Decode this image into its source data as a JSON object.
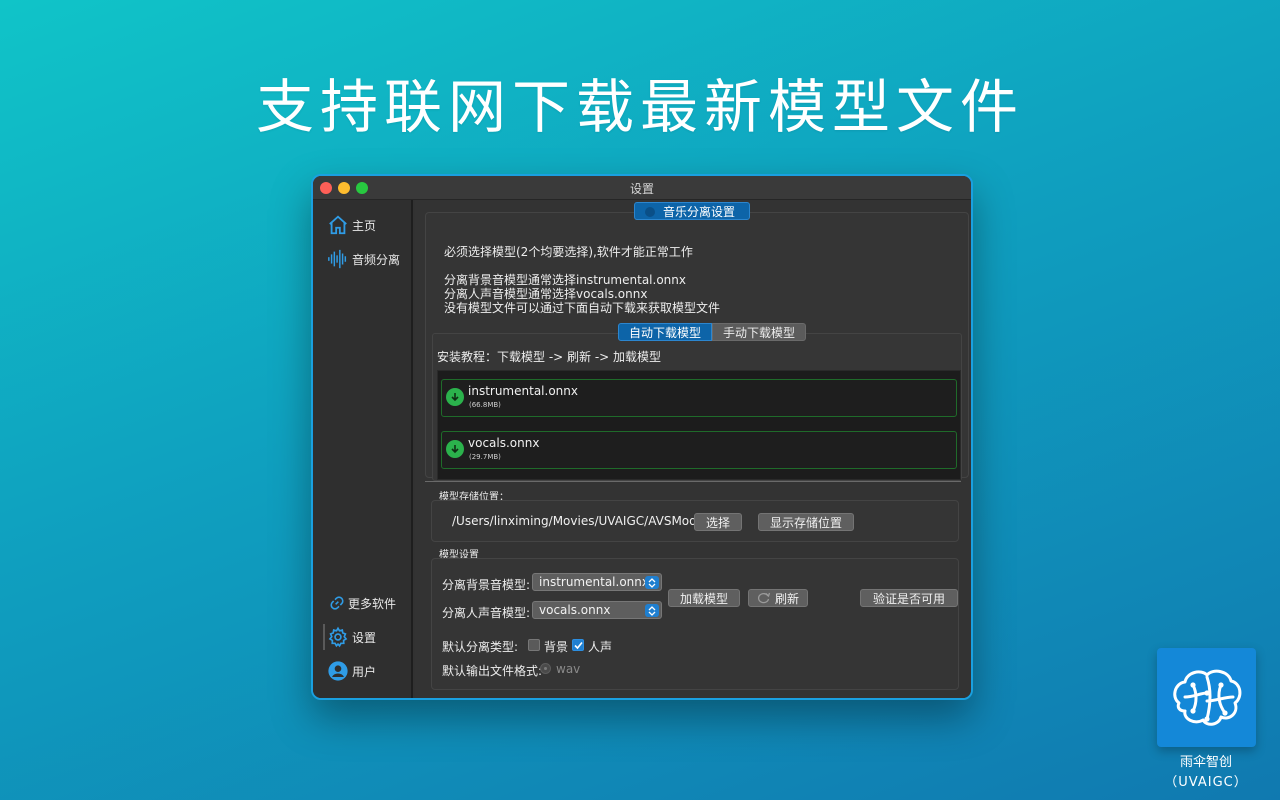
{
  "headline": "支持联网下载最新模型文件",
  "window": {
    "title": "设置"
  },
  "sidebar": {
    "items": [
      {
        "label": "主页",
        "icon": "home-icon"
      },
      {
        "label": "音频分离",
        "icon": "waveform-icon"
      },
      {
        "label": "更多软件",
        "icon": "link-icon"
      },
      {
        "label": "设置",
        "icon": "gear-icon"
      },
      {
        "label": "用户",
        "icon": "user-icon"
      }
    ]
  },
  "music_settings": {
    "title": "音乐分离设置",
    "info_required": "必须选择模型(2个均要选择),软件才能正常工作",
    "info_bg": "分离背景音模型通常选择instrumental.onnx",
    "info_vocal": "分离人声音模型通常选择vocals.onnx",
    "info_download": "没有模型文件可以通过下面自动下载来获取模型文件",
    "tabs": [
      {
        "label": "自动下载模型",
        "active": true
      },
      {
        "label": "手动下载模型",
        "active": false
      }
    ],
    "install_tip": "安装教程：下载模型 -> 刷新 -> 加载模型",
    "downloads": [
      {
        "name": "instrumental.onnx",
        "size": "(66.8MB)"
      },
      {
        "name": "vocals.onnx",
        "size": "(29.7MB)"
      }
    ]
  },
  "storage": {
    "label": "模型存储位置：",
    "path": "/Users/linximing/Movies/UVAIGC/AVSModel",
    "choose_label": "选择",
    "show_label": "显示存储位置"
  },
  "model_settings": {
    "label": "模型设置",
    "bg_label": "分离背景音模型:",
    "bg_value": "instrumental.onnx",
    "vocal_label": "分离人声音模型:",
    "vocal_value": "vocals.onnx",
    "load_label": "加载模型",
    "refresh_label": "刷新",
    "verify_label": "验证是否可用",
    "type_label": "默认分离类型:",
    "type_bg": "背景",
    "type_bg_checked": false,
    "type_vocal": "人声",
    "type_vocal_checked": true,
    "format_label": "默认输出文件格式:",
    "format_value": "wav"
  },
  "brand": {
    "name": "雨伞智创",
    "en": "（UVAIGC）"
  },
  "colors": {
    "accent": "#0d64a8",
    "download": "#2bb24c",
    "frame": "#1aa0e0"
  }
}
